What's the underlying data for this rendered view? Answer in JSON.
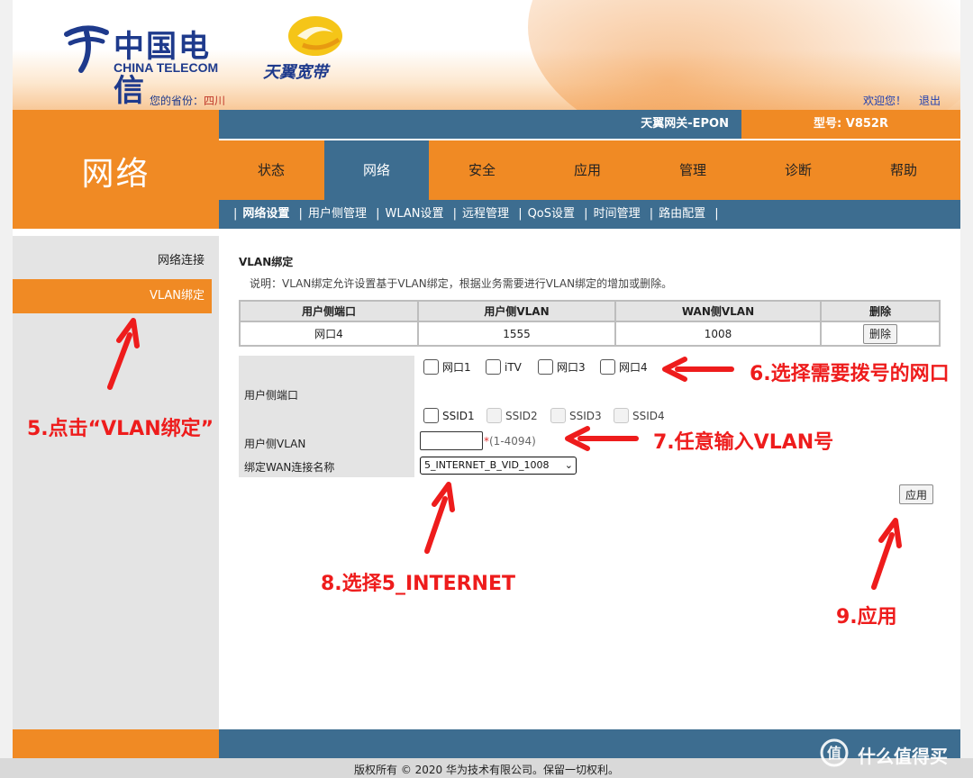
{
  "header": {
    "logo_cn": "中国电信",
    "logo_en": "CHINA TELECOM",
    "brand": "天翼宽带",
    "province_label": "您的省份：",
    "province_value": "四川",
    "welcome": "欢迎您！",
    "logout": "退出"
  },
  "device": {
    "gateway_name": "天翼网关-EPON",
    "model": "型号: V852R"
  },
  "section_title": "网络",
  "nav": {
    "items": [
      "状态",
      "网络",
      "安全",
      "应用",
      "管理",
      "诊断",
      "帮助"
    ],
    "active": "网络"
  },
  "subnav": {
    "items": [
      "网络设置",
      "用户侧管理",
      "WLAN设置",
      "远程管理",
      "QoS设置",
      "时间管理",
      "路由配置"
    ],
    "separator": "|"
  },
  "sidebar": {
    "items": [
      "网络连接",
      "VLAN绑定"
    ],
    "active": "VLAN绑定"
  },
  "page": {
    "heading": "VLAN绑定",
    "description": "说明：VLAN绑定允许设置基于VLAN绑定，根据业务需要进行VLAN绑定的增加或删除。"
  },
  "table": {
    "columns": [
      "用户侧端口",
      "用户侧VLAN",
      "WAN侧VLAN",
      "删除"
    ],
    "rows": [
      {
        "port": "网口4",
        "user_vlan": "1555",
        "wan_vlan": "1008",
        "delete_label": "删除"
      }
    ]
  },
  "form": {
    "port_label": "用户侧端口",
    "ports": [
      "网口1",
      "iTV",
      "网口3",
      "网口4"
    ],
    "ssids": [
      "SSID1",
      "SSID2",
      "SSID3",
      "SSID4"
    ],
    "vlan_label": "用户侧VLAN",
    "vlan_value": "",
    "vlan_required": "*",
    "vlan_range": "(1-4094)",
    "wan_label": "绑定WAN连接名称",
    "wan_selected": "5_INTERNET_B_VID_1008",
    "apply_label": "应用"
  },
  "footer": {
    "copyright": "版权所有 © 2020 华为技术有限公司。保留一切权利。"
  },
  "annotations": {
    "step5": "5.点击“VLAN绑定”",
    "step6": "6.选择需要拨号的网口",
    "step7": "7.任意输入VLAN号",
    "step8": "8.选择5_INTERNET",
    "step9": "9.应用",
    "color": "#ee1c1c"
  },
  "watermark": "什么值得买",
  "colors": {
    "orange": "#f08a24",
    "steel_blue": "#3d6d90",
    "sidebar_gray": "#e4e4e4"
  }
}
